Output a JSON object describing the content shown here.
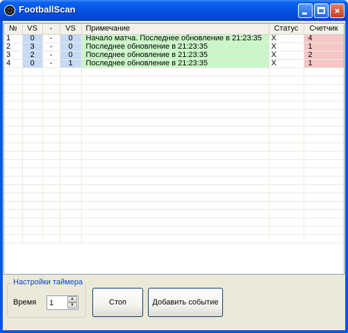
{
  "window": {
    "title": "FootballScan",
    "controls": {
      "minimize": "minimize",
      "maximize": "maximize",
      "close": "×"
    }
  },
  "table": {
    "columns": [
      "№",
      "VS",
      "-",
      "VS",
      "Примечание",
      "Статус",
      "Счетчик"
    ],
    "rows": [
      {
        "n": "1",
        "vs1": "0",
        "dash": "-",
        "vs2": "0",
        "note": "Начало матча. Последнее обновление в 21:23:35",
        "status": "X",
        "counter": "4"
      },
      {
        "n": "2",
        "vs1": "3",
        "dash": "-",
        "vs2": "0",
        "note": "Последнее обновление в 21:23:35",
        "status": "X",
        "counter": "1"
      },
      {
        "n": "3",
        "vs1": "2",
        "dash": "-",
        "vs2": "0",
        "note": "Последнее обновление в 21:23:35",
        "status": "X",
        "counter": "2"
      },
      {
        "n": "4",
        "vs1": "0",
        "dash": "-",
        "vs2": "1",
        "note": "Последнее обновление в 21:23:35",
        "status": "X",
        "counter": "1"
      }
    ],
    "empty_row_count": 21
  },
  "timer": {
    "group_label": "Настройки таймера",
    "time_label": "Время",
    "value": "1"
  },
  "buttons": {
    "stop": "Стоп",
    "add_event": "Добавить событие"
  },
  "colors": {
    "titlebar": "#0553e2",
    "score_cell": "#c6d9f6",
    "note_cell": "#c8f6c8",
    "counter_cell": "#f6c6c6",
    "group_label": "#0046d5",
    "face": "#ece9d8"
  }
}
